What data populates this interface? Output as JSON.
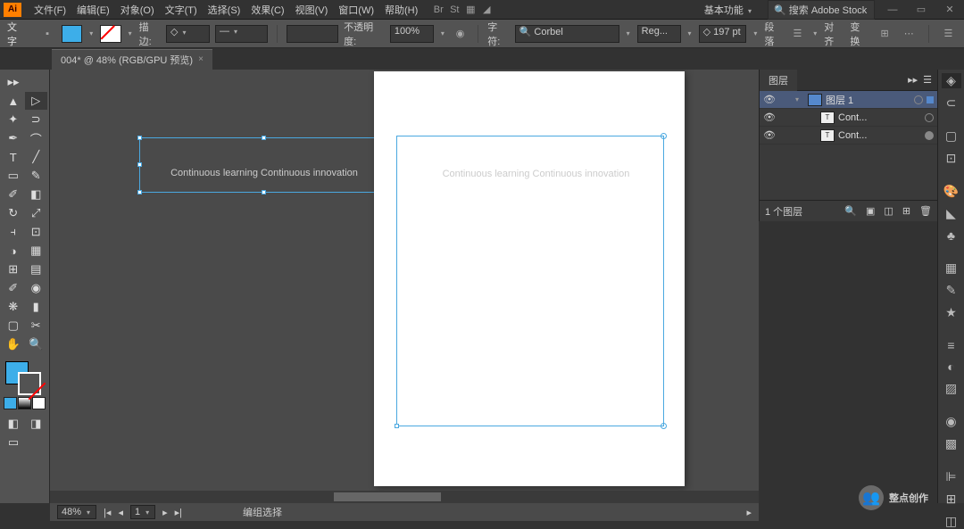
{
  "app": {
    "logo": "Ai"
  },
  "menu": [
    "文件(F)",
    "编辑(E)",
    "对象(O)",
    "文字(T)",
    "选择(S)",
    "效果(C)",
    "视图(V)",
    "窗口(W)",
    "帮助(H)"
  ],
  "titlebar": {
    "workspace": "基本功能",
    "stock_placeholder": "搜索 Adobe Stock"
  },
  "control": {
    "tool_label": "文字",
    "stroke_label": "描边:",
    "opacity_label": "不透明度:",
    "opacity_val": "100%",
    "char_label": "字符:",
    "font": "Corbel",
    "style": "Reg...",
    "size": "197 pt",
    "para_label": "段落",
    "align_label": "对齐",
    "transform_label": "变换"
  },
  "doc_tab": {
    "title": "004* @ 48% (RGB/GPU 预览)"
  },
  "canvas_text": "Continuous learning Continuous innovation",
  "layers_panel": {
    "title": "图层",
    "rows": [
      {
        "name": "图层 1",
        "type": "layer",
        "expanded": true,
        "selected": true
      },
      {
        "name": "Cont...",
        "type": "text",
        "selected": false
      },
      {
        "name": "Cont...",
        "type": "text",
        "selected": false,
        "targeted": true
      }
    ],
    "footer": "1 个图层"
  },
  "status": {
    "zoom": "48%",
    "page_nav": "1",
    "tool_hint": "编组选择"
  },
  "watermark": "整点创作"
}
